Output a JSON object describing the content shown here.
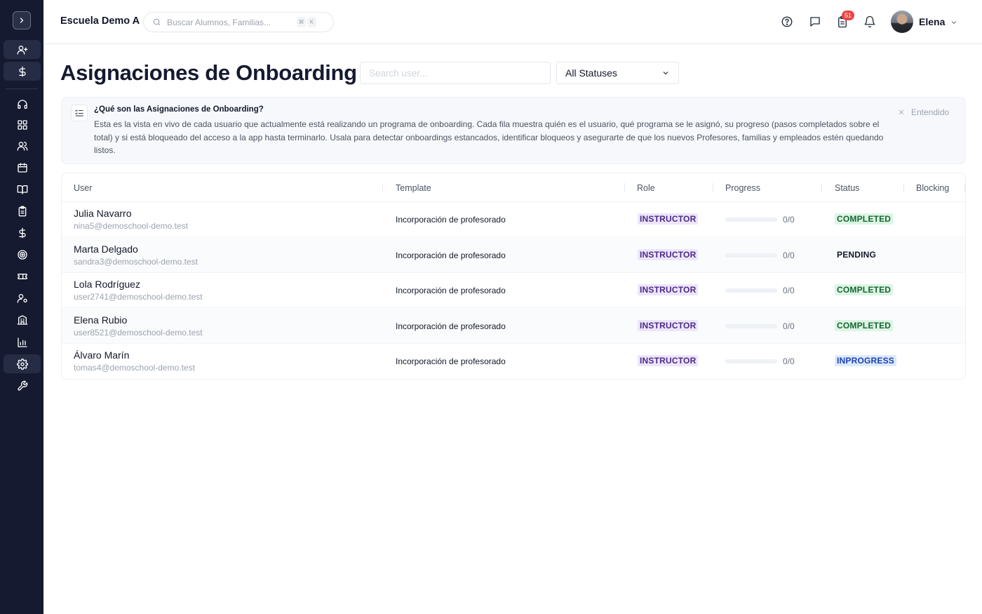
{
  "header": {
    "school_name": "Escuela Demo A",
    "search_placeholder": "Buscar Alumnos, Familias...",
    "shortcut_keys": [
      "⌘",
      "K"
    ],
    "notification_count": "51",
    "user_name": "Elena"
  },
  "page": {
    "title": "Asignaciones de Onboarding",
    "user_search_placeholder": "Search user...",
    "status_filter": "All Statuses"
  },
  "info": {
    "title": "¿Qué son las Asignaciones de Onboarding?",
    "body": "Esta es la vista en vivo de cada usuario que actualmente está realizando un programa de onboarding. Cada fila muestra quién es el usuario, qué programa se le asignó, su progreso (pasos completados sobre el total) y si está bloqueado del acceso a la app hasta terminarlo. Usala para detectar onboardings estancados, identificar bloqueos y asegurarte de que los nuevos Profesores, familias y empleados estén quedando listos.",
    "dismiss_label": "Entendido"
  },
  "table": {
    "columns": [
      "User",
      "Template",
      "Role",
      "Progress",
      "Status",
      "Blocking"
    ],
    "rows": [
      {
        "name": "Julia Navarro",
        "email": "nina5@demoschool-demo.test",
        "template": "Incorporación de profesorado",
        "role": "INSTRUCTOR",
        "progress": "0/0",
        "progress_fraction": 0,
        "status": "COMPLETED",
        "blocking": ""
      },
      {
        "name": "Marta Delgado",
        "email": "sandra3@demoschool-demo.test",
        "template": "Incorporación de profesorado",
        "role": "INSTRUCTOR",
        "progress": "0/0",
        "progress_fraction": 0,
        "status": "PENDING",
        "blocking": ""
      },
      {
        "name": "Lola Rodríguez",
        "email": "user2741@demoschool-demo.test",
        "template": "Incorporación de profesorado",
        "role": "INSTRUCTOR",
        "progress": "0/0",
        "progress_fraction": 0,
        "status": "COMPLETED",
        "blocking": ""
      },
      {
        "name": "Elena Rubio",
        "email": "user8521@demoschool-demo.test",
        "template": "Incorporación de profesorado",
        "role": "INSTRUCTOR",
        "progress": "0/0",
        "progress_fraction": 0,
        "status": "COMPLETED",
        "blocking": ""
      },
      {
        "name": "Álvaro Marín",
        "email": "tomas4@demoschool-demo.test",
        "template": "Incorporación de profesorado",
        "role": "INSTRUCTOR",
        "progress": "0/0",
        "progress_fraction": 0,
        "status": "INPROGRESS",
        "blocking": ""
      }
    ]
  },
  "sidebar": {
    "items": [
      {
        "icon": "user-plus-icon"
      },
      {
        "icon": "dollar-icon"
      },
      {
        "icon": "headset-icon"
      },
      {
        "icon": "dashboard-icon"
      },
      {
        "icon": "users-icon"
      },
      {
        "icon": "calendar-icon"
      },
      {
        "icon": "book-icon"
      },
      {
        "icon": "clipboard-icon"
      },
      {
        "icon": "dollar-icon"
      },
      {
        "icon": "target-icon"
      },
      {
        "icon": "ticket-icon"
      },
      {
        "icon": "user-cog-icon"
      },
      {
        "icon": "building-icon"
      },
      {
        "icon": "bar-chart-icon"
      },
      {
        "icon": "gear-icon"
      },
      {
        "icon": "wrench-icon"
      }
    ]
  },
  "colors": {
    "sidebar_bg": "#151a30",
    "role_badge_bg": "#ede5fb",
    "completed_badge_bg": "#dcf5e3",
    "inprogress_badge_bg": "#dbeafe",
    "notification_badge": "#ef4444"
  }
}
